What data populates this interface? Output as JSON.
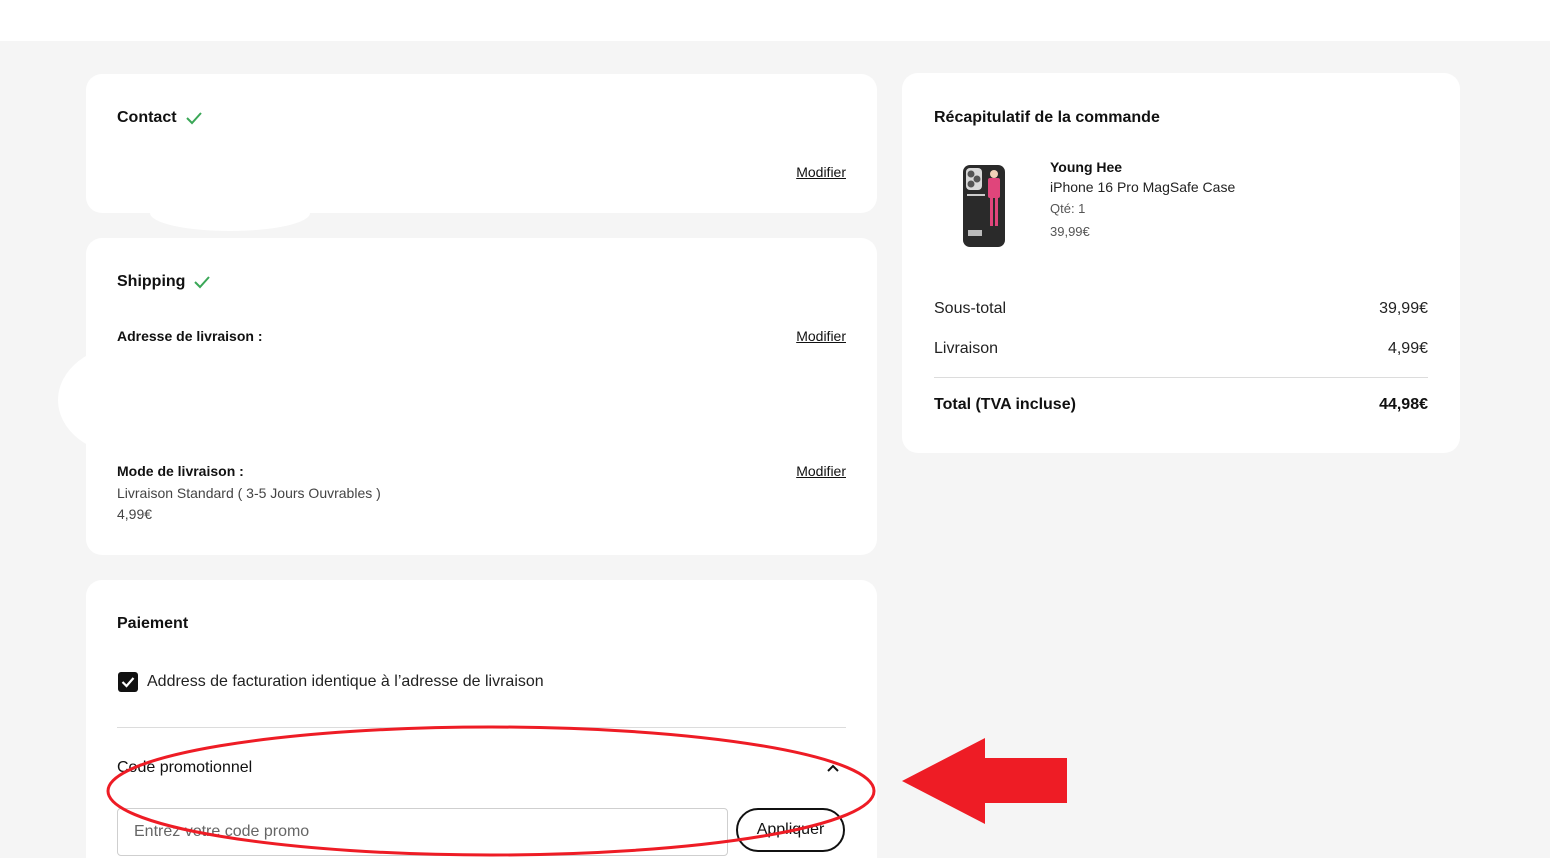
{
  "contact": {
    "title": "Contact",
    "modify_label": "Modifier"
  },
  "shipping": {
    "title": "Shipping",
    "address_label": "Adresse de livraison :",
    "address_modify": "Modifier",
    "method_label": "Mode de livraison :",
    "method_modify": "Modifier",
    "method_value": "Livraison Standard ( 3-5 Jours Ouvrables )",
    "method_price": "4,99€"
  },
  "payment": {
    "title": "Paiement",
    "billing_same_label": "Address de facturation identique à l’adresse de livraison",
    "billing_same_checked": true,
    "promo_title": "Code promotionnel",
    "promo_placeholder": "Entrez votre code promo",
    "promo_value": "",
    "apply_label": "Appliquer"
  },
  "summary": {
    "title": "Récapitulatif de la commande",
    "product": {
      "name": "Young Hee",
      "description": "iPhone 16 Pro MagSafe Case",
      "quantity": "Qté: 1",
      "price": "39,99€"
    },
    "subtotal_label": "Sous-total",
    "subtotal_value": "39,99€",
    "shipping_label": "Livraison",
    "shipping_value": "4,99€",
    "total_label": "Total (TVA incluse)",
    "total_value": "44,98€"
  },
  "colors": {
    "check_green": "#3aa757",
    "annotation_red": "#ee1c25",
    "page_bg": "#f5f5f5"
  },
  "icons": {
    "contact_status": "check-icon",
    "shipping_status": "check-icon",
    "promo_toggle": "chevron-up-icon",
    "annotation": "arrow-left-icon"
  }
}
